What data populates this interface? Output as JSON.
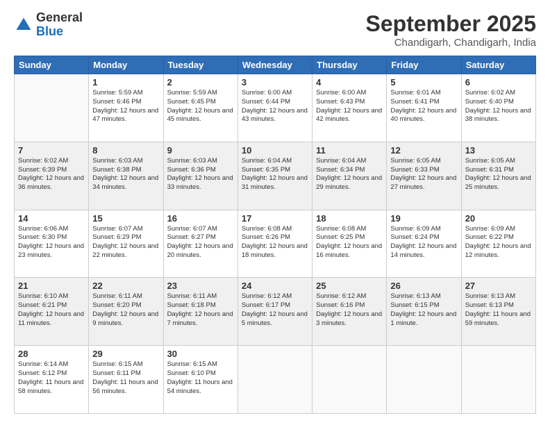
{
  "logo": {
    "general": "General",
    "blue": "Blue"
  },
  "header": {
    "month": "September 2025",
    "location": "Chandigarh, Chandigarh, India"
  },
  "days_of_week": [
    "Sunday",
    "Monday",
    "Tuesday",
    "Wednesday",
    "Thursday",
    "Friday",
    "Saturday"
  ],
  "weeks": [
    [
      {
        "day": "",
        "info": ""
      },
      {
        "day": "1",
        "info": "Sunrise: 5:59 AM\nSunset: 6:46 PM\nDaylight: 12 hours\nand 47 minutes."
      },
      {
        "day": "2",
        "info": "Sunrise: 5:59 AM\nSunset: 6:45 PM\nDaylight: 12 hours\nand 45 minutes."
      },
      {
        "day": "3",
        "info": "Sunrise: 6:00 AM\nSunset: 6:44 PM\nDaylight: 12 hours\nand 43 minutes."
      },
      {
        "day": "4",
        "info": "Sunrise: 6:00 AM\nSunset: 6:43 PM\nDaylight: 12 hours\nand 42 minutes."
      },
      {
        "day": "5",
        "info": "Sunrise: 6:01 AM\nSunset: 6:41 PM\nDaylight: 12 hours\nand 40 minutes."
      },
      {
        "day": "6",
        "info": "Sunrise: 6:02 AM\nSunset: 6:40 PM\nDaylight: 12 hours\nand 38 minutes."
      }
    ],
    [
      {
        "day": "7",
        "info": "Sunrise: 6:02 AM\nSunset: 6:39 PM\nDaylight: 12 hours\nand 36 minutes."
      },
      {
        "day": "8",
        "info": "Sunrise: 6:03 AM\nSunset: 6:38 PM\nDaylight: 12 hours\nand 34 minutes."
      },
      {
        "day": "9",
        "info": "Sunrise: 6:03 AM\nSunset: 6:36 PM\nDaylight: 12 hours\nand 33 minutes."
      },
      {
        "day": "10",
        "info": "Sunrise: 6:04 AM\nSunset: 6:35 PM\nDaylight: 12 hours\nand 31 minutes."
      },
      {
        "day": "11",
        "info": "Sunrise: 6:04 AM\nSunset: 6:34 PM\nDaylight: 12 hours\nand 29 minutes."
      },
      {
        "day": "12",
        "info": "Sunrise: 6:05 AM\nSunset: 6:33 PM\nDaylight: 12 hours\nand 27 minutes."
      },
      {
        "day": "13",
        "info": "Sunrise: 6:05 AM\nSunset: 6:31 PM\nDaylight: 12 hours\nand 25 minutes."
      }
    ],
    [
      {
        "day": "14",
        "info": "Sunrise: 6:06 AM\nSunset: 6:30 PM\nDaylight: 12 hours\nand 23 minutes."
      },
      {
        "day": "15",
        "info": "Sunrise: 6:07 AM\nSunset: 6:29 PM\nDaylight: 12 hours\nand 22 minutes."
      },
      {
        "day": "16",
        "info": "Sunrise: 6:07 AM\nSunset: 6:27 PM\nDaylight: 12 hours\nand 20 minutes."
      },
      {
        "day": "17",
        "info": "Sunrise: 6:08 AM\nSunset: 6:26 PM\nDaylight: 12 hours\nand 18 minutes."
      },
      {
        "day": "18",
        "info": "Sunrise: 6:08 AM\nSunset: 6:25 PM\nDaylight: 12 hours\nand 16 minutes."
      },
      {
        "day": "19",
        "info": "Sunrise: 6:09 AM\nSunset: 6:24 PM\nDaylight: 12 hours\nand 14 minutes."
      },
      {
        "day": "20",
        "info": "Sunrise: 6:09 AM\nSunset: 6:22 PM\nDaylight: 12 hours\nand 12 minutes."
      }
    ],
    [
      {
        "day": "21",
        "info": "Sunrise: 6:10 AM\nSunset: 6:21 PM\nDaylight: 12 hours\nand 11 minutes."
      },
      {
        "day": "22",
        "info": "Sunrise: 6:11 AM\nSunset: 6:20 PM\nDaylight: 12 hours\nand 9 minutes."
      },
      {
        "day": "23",
        "info": "Sunrise: 6:11 AM\nSunset: 6:18 PM\nDaylight: 12 hours\nand 7 minutes."
      },
      {
        "day": "24",
        "info": "Sunrise: 6:12 AM\nSunset: 6:17 PM\nDaylight: 12 hours\nand 5 minutes."
      },
      {
        "day": "25",
        "info": "Sunrise: 6:12 AM\nSunset: 6:16 PM\nDaylight: 12 hours\nand 3 minutes."
      },
      {
        "day": "26",
        "info": "Sunrise: 6:13 AM\nSunset: 6:15 PM\nDaylight: 12 hours\nand 1 minute."
      },
      {
        "day": "27",
        "info": "Sunrise: 6:13 AM\nSunset: 6:13 PM\nDaylight: 11 hours\nand 59 minutes."
      }
    ],
    [
      {
        "day": "28",
        "info": "Sunrise: 6:14 AM\nSunset: 6:12 PM\nDaylight: 11 hours\nand 58 minutes."
      },
      {
        "day": "29",
        "info": "Sunrise: 6:15 AM\nSunset: 6:11 PM\nDaylight: 11 hours\nand 56 minutes."
      },
      {
        "day": "30",
        "info": "Sunrise: 6:15 AM\nSunset: 6:10 PM\nDaylight: 11 hours\nand 54 minutes."
      },
      {
        "day": "",
        "info": ""
      },
      {
        "day": "",
        "info": ""
      },
      {
        "day": "",
        "info": ""
      },
      {
        "day": "",
        "info": ""
      }
    ]
  ]
}
